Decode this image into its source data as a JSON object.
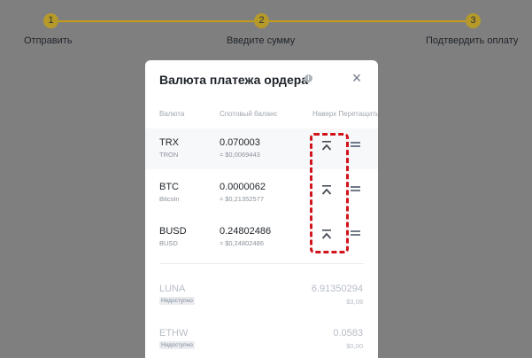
{
  "stepper": {
    "steps": [
      {
        "number": "1",
        "label": "Отправить"
      },
      {
        "number": "2",
        "label": "Введите сумму"
      },
      {
        "number": "3",
        "label": "Подтвердить оплату"
      }
    ]
  },
  "modal": {
    "title": "Валюта платежа ордера",
    "info_icon": "i",
    "close_icon": "×",
    "columns": {
      "currency": "Валюта",
      "spot_balance": "Спотовый баланс",
      "actions": "Наверх Перетащить"
    },
    "available": [
      {
        "symbol": "TRX",
        "name": "TRON",
        "balance": "0.070003",
        "fiat": "≈ $0,0069443"
      },
      {
        "symbol": "BTC",
        "name": "Bitcoin",
        "balance": "0.0000062",
        "fiat": "≈ $0,21352577"
      },
      {
        "symbol": "BUSD",
        "name": "BUSD",
        "balance": "0.24802486",
        "fiat": "≈ $0,24802486"
      }
    ],
    "unavailable": [
      {
        "symbol": "LUNA",
        "badge": "Недоступно",
        "balance": "6.91350294",
        "fiat": "$3,08"
      },
      {
        "symbol": "ETHW",
        "badge": "Недоступно",
        "balance": "0.0583",
        "fiat": "$0,00"
      }
    ]
  },
  "colors": {
    "accent": "#c69b18",
    "highlight": "#d0141b",
    "overlay": "#7f7f7f"
  }
}
